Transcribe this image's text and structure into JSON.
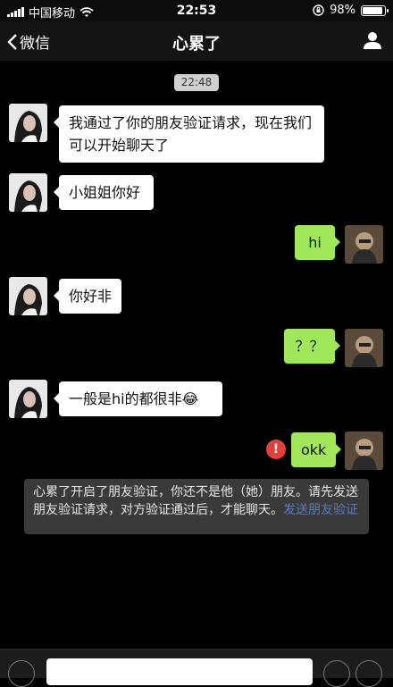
{
  "status_bar": {
    "carrier": "中国移动",
    "time": "22:53",
    "battery": "98%",
    "battery_level": 0.98
  },
  "nav": {
    "back_label": "微信",
    "title": "心累了"
  },
  "chat": {
    "timestamp": "22:48",
    "messages": [
      {
        "side": "in",
        "text": "我通过了你的朋友验证请求，现在我们可以开始聊天了"
      },
      {
        "side": "in",
        "text": "小姐姐你好"
      },
      {
        "side": "out",
        "text": "hi"
      },
      {
        "side": "in",
        "text": "你好非"
      },
      {
        "side": "out",
        "text": "？？"
      },
      {
        "side": "in",
        "text": "一般是hi的都很非",
        "emoji": "😂"
      },
      {
        "side": "out",
        "text": "okk",
        "status": "failed"
      }
    ],
    "failed_mark": "!",
    "notice": {
      "text": "心累了开启了朋友验证，你还不是他（她）朋友。请先发送朋友验证请求，对方验证通过后，才能聊天。",
      "link": "发送朋友验证"
    }
  },
  "colors": {
    "background": "#000000",
    "incoming_bubble": "#ffffff",
    "outgoing_bubble": "#a0e75a",
    "error_badge": "#e2413b",
    "notice_link": "#5b7bb4"
  }
}
